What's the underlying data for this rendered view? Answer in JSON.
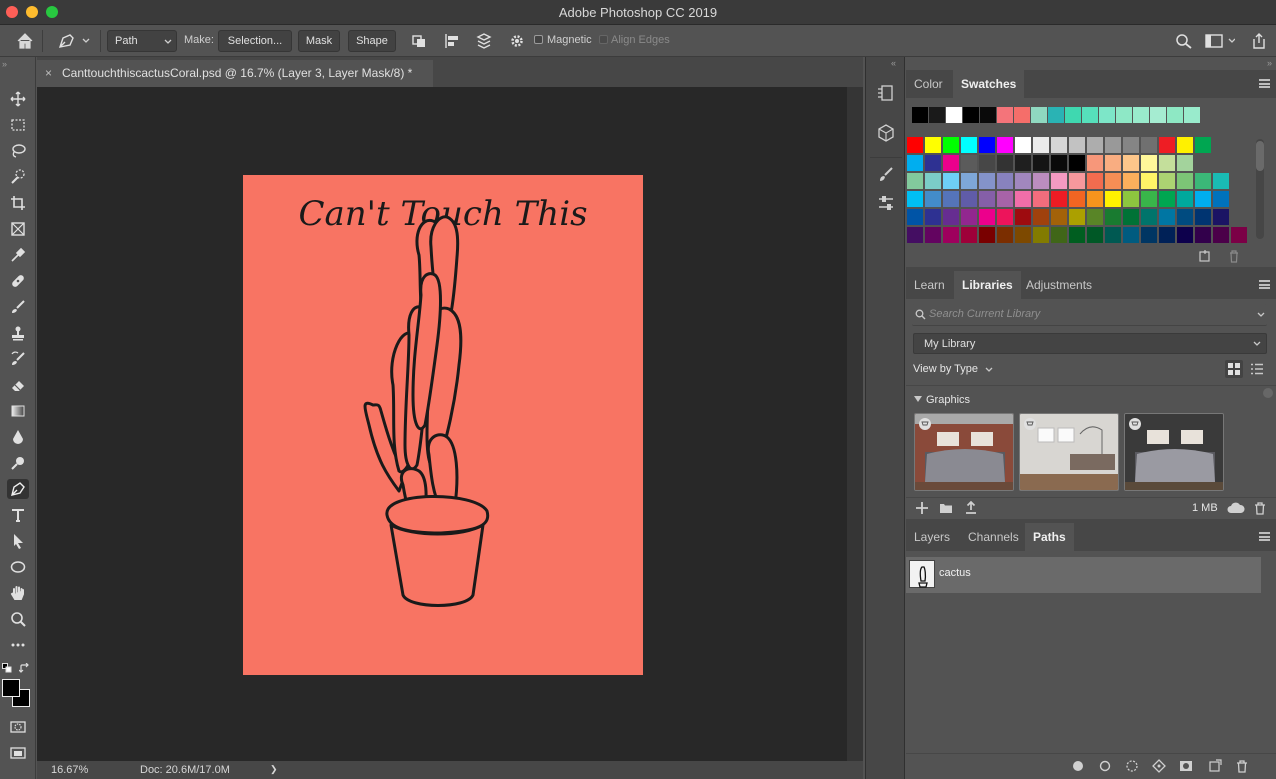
{
  "app": {
    "title": "Adobe Photoshop CC 2019"
  },
  "options": {
    "mode": "Path",
    "make_label": "Make:",
    "selection_button": "Selection...",
    "mask_button": "Mask",
    "shape_button": "Shape",
    "magnetic_label": "Magnetic",
    "align_edges_label": "Align Edges"
  },
  "document": {
    "tab_title": "CanttouchthiscactusCoral.psd @ 16.7% (Layer 3, Layer Mask/8) *",
    "close": "×",
    "artboard_text": "Can't Touch This",
    "artboard_color": "#f87463"
  },
  "status": {
    "zoom": "16.67%",
    "doc": "Doc: 20.6M/17.0M",
    "arrow": "❯"
  },
  "tools": [
    "move",
    "marquee",
    "lasso",
    "quick-select",
    "crop",
    "frame",
    "eyedropper",
    "healing",
    "brush",
    "stamp",
    "history-brush",
    "eraser",
    "gradient",
    "blur",
    "dodge",
    "pen",
    "type",
    "path-select",
    "ellipse",
    "hand",
    "zoom",
    "more",
    "quick-mask",
    "screen-mode"
  ],
  "color_panel": {
    "tabs": [
      "Color",
      "Swatches"
    ],
    "active_tab": "Swatches",
    "recent_swatches": [
      "#000000",
      "#1a1a1a",
      "#ffffff",
      "#000000",
      "#0a0a0a",
      "#f4747a",
      "#f56e6a",
      "#8fd8c0",
      "#2ab3b4",
      "#3fd8b0",
      "#56e0bb",
      "#7de6c8",
      "#8ee8c6",
      "#99ebcc",
      "#a5ecd1",
      "#8ee8c4",
      "#99ebcc"
    ],
    "grid": [
      [
        "#ff0000",
        "#ffff00",
        "#00ff00",
        "#00ffff",
        "#0000ff",
        "#ff00ff",
        "#ffffff",
        "#ebebeb",
        "#d6d6d6",
        "#c2c2c2",
        "#adadad",
        "#999999",
        "#858585",
        "#707070",
        "#ee1d24",
        "#fff100",
        "#00a651"
      ],
      [
        "#00aeef",
        "#2e3192",
        "#ec008c",
        "#5b5b5b",
        "#474747",
        "#333333",
        "#1f1f1f",
        "#141414",
        "#0a0a0a",
        "#000000",
        "#f7977a",
        "#f9ad81",
        "#fdc68a",
        "#fff79a",
        "#c4df9b",
        "#a3d39c"
      ],
      [
        "#82ca9d",
        "#7bcdc8",
        "#6ecff6",
        "#7ea7d8",
        "#8493ca",
        "#8882be",
        "#a187be",
        "#bc8dbf",
        "#f49ac2",
        "#f6989d",
        "#f26c4f",
        "#f68e55",
        "#fbaf5c",
        "#fff467",
        "#acd372",
        "#7cc576",
        "#3bb878",
        "#1abbb4"
      ],
      [
        "#00bff3",
        "#438cca",
        "#5574b9",
        "#605ca8",
        "#855fa8",
        "#a763a8",
        "#f06ea9",
        "#f26d7d",
        "#ed1c24",
        "#f26522",
        "#f7941d",
        "#fff200",
        "#8dc63f",
        "#39b54a",
        "#00a651",
        "#00a99d",
        "#00aeef",
        "#0072bc"
      ],
      [
        "#0054a6",
        "#2e3192",
        "#662d91",
        "#92278f",
        "#ec008c",
        "#ed145b",
        "#9e0b0f",
        "#a0410d",
        "#a36209",
        "#aba000",
        "#598527",
        "#197b30",
        "#007236",
        "#00746b",
        "#0076a3",
        "#004b80",
        "#003471",
        "#1b1464"
      ],
      [
        "#440e62",
        "#630460",
        "#9e005d",
        "#9e0039",
        "#790000",
        "#7b2e00",
        "#7d4900",
        "#827b00",
        "#406618",
        "#005e20",
        "#005826",
        "#005952",
        "#005b7f",
        "#003663",
        "#002157",
        "#0d004c",
        "#32004b",
        "#4b0049",
        "#7b0046",
        "#7a0026",
        "#c7b299"
      ]
    ]
  },
  "libraries": {
    "tabs": [
      "Learn",
      "Libraries",
      "Adjustments"
    ],
    "active_tab": "Libraries",
    "search_placeholder": "Search Current Library",
    "library_name": "My Library",
    "view_by": "View by Type",
    "section": "Graphics",
    "size": "1 MB"
  },
  "paths_panel": {
    "tabs": [
      "Layers",
      "Channels",
      "Paths"
    ],
    "active_tab": "Paths",
    "items": [
      {
        "name": "cactus"
      }
    ]
  }
}
